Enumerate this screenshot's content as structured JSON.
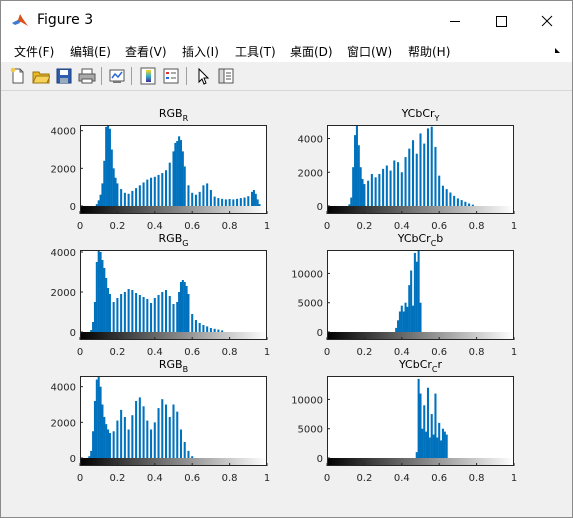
{
  "window": {
    "title": "Figure 3"
  },
  "menu": [
    "文件(F)",
    "编辑(E)",
    "查看(V)",
    "插入(I)",
    "工具(T)",
    "桌面(D)",
    "窗口(W)",
    "帮助(H)"
  ],
  "toolbar": [
    "new-figure-icon",
    "open-folder-icon",
    "save-icon",
    "print-icon",
    "link-plot-icon",
    "insert-colorbar-icon",
    "insert-legend-icon",
    "edit-plot-arrow-icon",
    "property-editor-icon"
  ],
  "colors": {
    "bars": "#0072bd"
  },
  "chart_data": [
    {
      "type": "bar",
      "title": "RGB",
      "title_sub": "R",
      "xlim": [
        0,
        1
      ],
      "ylim": [
        0,
        4300
      ],
      "xticks": [
        "0",
        "0.2",
        "0.4",
        "0.6",
        "0.8",
        "1"
      ],
      "yticks": [
        {
          "v": 0,
          "label": "0"
        },
        {
          "v": 2000,
          "label": "2000"
        },
        {
          "v": 4000,
          "label": "4000"
        }
      ],
      "colorbar": "gray",
      "x": [
        0.09,
        0.1,
        0.11,
        0.12,
        0.13,
        0.14,
        0.15,
        0.16,
        0.17,
        0.18,
        0.19,
        0.2,
        0.22,
        0.24,
        0.26,
        0.28,
        0.3,
        0.32,
        0.34,
        0.36,
        0.38,
        0.4,
        0.42,
        0.44,
        0.46,
        0.48,
        0.5,
        0.51,
        0.52,
        0.53,
        0.54,
        0.55,
        0.56,
        0.58,
        0.6,
        0.62,
        0.64,
        0.66,
        0.68,
        0.7,
        0.72,
        0.74,
        0.76,
        0.78,
        0.8,
        0.82,
        0.84,
        0.86,
        0.88,
        0.9,
        0.92,
        0.93,
        0.94,
        0.95,
        0.96
      ],
      "values": [
        100,
        300,
        600,
        1200,
        2400,
        4200,
        4300,
        4100,
        3000,
        2000,
        1500,
        1200,
        900,
        700,
        650,
        800,
        950,
        1100,
        1250,
        1400,
        1500,
        1550,
        1650,
        1750,
        1900,
        2300,
        2900,
        3350,
        3450,
        3700,
        3500,
        2900,
        2100,
        1100,
        700,
        600,
        750,
        1100,
        1200,
        850,
        500,
        420,
        380,
        350,
        370,
        350,
        380,
        420,
        450,
        520,
        750,
        850,
        650,
        350,
        100
      ]
    },
    {
      "type": "bar",
      "title": "YCbCr",
      "title_sub": "Y",
      "xlim": [
        0,
        1
      ],
      "ylim": [
        0,
        4800
      ],
      "xticks": [
        "0",
        "0.2",
        "0.4",
        "0.6",
        "0.8",
        "1"
      ],
      "yticks": [
        {
          "v": 0,
          "label": "0"
        },
        {
          "v": 2000,
          "label": "2000"
        },
        {
          "v": 4000,
          "label": "4000"
        }
      ],
      "colorbar": "gray",
      "x": [
        0.12,
        0.13,
        0.14,
        0.15,
        0.16,
        0.17,
        0.18,
        0.19,
        0.2,
        0.22,
        0.24,
        0.26,
        0.28,
        0.3,
        0.32,
        0.34,
        0.36,
        0.38,
        0.4,
        0.42,
        0.44,
        0.46,
        0.48,
        0.5,
        0.52,
        0.54,
        0.56,
        0.58,
        0.6,
        0.62,
        0.64,
        0.66,
        0.68,
        0.7,
        0.72,
        0.74,
        0.76,
        0.78
      ],
      "values": [
        100,
        500,
        2300,
        4200,
        4800,
        3600,
        2300,
        1600,
        1300,
        1500,
        1900,
        1700,
        1900,
        2200,
        2400,
        2100,
        2700,
        2600,
        2000,
        2900,
        3400,
        3900,
        3100,
        4300,
        3700,
        4600,
        4700,
        3500,
        1800,
        1200,
        1000,
        800,
        600,
        450,
        350,
        250,
        150,
        80
      ]
    },
    {
      "type": "bar",
      "title": "RGB",
      "title_sub": "G",
      "xlim": [
        0,
        1
      ],
      "ylim": [
        0,
        4100
      ],
      "xticks": [
        "0",
        "0.2",
        "0.4",
        "0.6",
        "0.8",
        "1"
      ],
      "yticks": [
        {
          "v": 0,
          "label": "0"
        },
        {
          "v": 2000,
          "label": "2000"
        },
        {
          "v": 4000,
          "label": "4000"
        }
      ],
      "colorbar": "gray",
      "x": [
        0.06,
        0.07,
        0.08,
        0.09,
        0.1,
        0.11,
        0.12,
        0.13,
        0.14,
        0.15,
        0.16,
        0.18,
        0.2,
        0.22,
        0.24,
        0.26,
        0.28,
        0.3,
        0.32,
        0.34,
        0.36,
        0.38,
        0.4,
        0.42,
        0.44,
        0.46,
        0.48,
        0.5,
        0.52,
        0.53,
        0.54,
        0.55,
        0.56,
        0.57,
        0.58,
        0.6,
        0.62,
        0.64,
        0.66,
        0.68,
        0.7,
        0.72,
        0.74,
        0.76
      ],
      "values": [
        100,
        500,
        1500,
        3500,
        4100,
        4000,
        3600,
        3200,
        2700,
        2200,
        1900,
        1500,
        1700,
        1900,
        2000,
        2150,
        2100,
        1950,
        1850,
        1750,
        1650,
        1450,
        1700,
        1850,
        2000,
        2100,
        1800,
        1400,
        1500,
        2000,
        2500,
        2600,
        2500,
        2300,
        1900,
        900,
        600,
        450,
        350,
        280,
        200,
        160,
        120,
        80
      ]
    },
    {
      "type": "bar",
      "title": "YCbCr",
      "title_sub": "C",
      "title_suffix": "b",
      "xlim": [
        0,
        1
      ],
      "ylim": [
        0,
        14000
      ],
      "xticks": [
        "0",
        "0.2",
        "0.4",
        "0.6",
        "0.8",
        "1"
      ],
      "yticks": [
        {
          "v": 0,
          "label": "0"
        },
        {
          "v": 5000,
          "label": "5000"
        },
        {
          "v": 10000,
          "label": "10000"
        }
      ],
      "colorbar": "gray",
      "x": [
        0.37,
        0.38,
        0.39,
        0.4,
        0.41,
        0.42,
        0.43,
        0.44,
        0.45,
        0.46,
        0.47,
        0.48,
        0.49,
        0.5
      ],
      "values": [
        700,
        2000,
        3500,
        4500,
        3500,
        5000,
        4300,
        8000,
        10500,
        4500,
        13500,
        12000,
        14000,
        5000
      ]
    },
    {
      "type": "bar",
      "title": "RGB",
      "title_sub": "B",
      "xlim": [
        0,
        1
      ],
      "ylim": [
        0,
        4600
      ],
      "xticks": [
        "0",
        "0.2",
        "0.4",
        "0.6",
        "0.8",
        "1"
      ],
      "yticks": [
        {
          "v": 0,
          "label": "0"
        },
        {
          "v": 2000,
          "label": "2000"
        },
        {
          "v": 4000,
          "label": "4000"
        }
      ],
      "colorbar": "gray",
      "x": [
        0.05,
        0.06,
        0.07,
        0.08,
        0.09,
        0.1,
        0.11,
        0.12,
        0.13,
        0.14,
        0.15,
        0.16,
        0.18,
        0.2,
        0.22,
        0.24,
        0.26,
        0.28,
        0.3,
        0.32,
        0.34,
        0.36,
        0.38,
        0.4,
        0.42,
        0.44,
        0.46,
        0.48,
        0.5,
        0.52,
        0.54,
        0.56,
        0.58,
        0.6
      ],
      "values": [
        100,
        400,
        1500,
        3200,
        4400,
        4600,
        4000,
        3000,
        2300,
        1900,
        1600,
        1400,
        1500,
        2100,
        2700,
        2300,
        1600,
        2400,
        3200,
        3400,
        2900,
        2100,
        1600,
        2000,
        2800,
        3300,
        3000,
        2300,
        3000,
        2600,
        1600,
        900,
        400,
        100
      ]
    },
    {
      "type": "bar",
      "title": "YCbCr",
      "title_sub": "C",
      "title_suffix": "r",
      "xlim": [
        0,
        1
      ],
      "ylim": [
        0,
        14000
      ],
      "xticks": [
        "0",
        "0.2",
        "0.4",
        "0.6",
        "0.8",
        "1"
      ],
      "yticks": [
        {
          "v": 0,
          "label": "0"
        },
        {
          "v": 5000,
          "label": "5000"
        },
        {
          "v": 10000,
          "label": "10000"
        }
      ],
      "colorbar": "gray",
      "x": [
        0.48,
        0.49,
        0.5,
        0.51,
        0.52,
        0.53,
        0.54,
        0.55,
        0.56,
        0.57,
        0.58,
        0.59,
        0.6,
        0.61,
        0.62,
        0.63,
        0.64
      ],
      "values": [
        1000,
        13500,
        11000,
        5000,
        9000,
        4500,
        12000,
        3500,
        7500,
        4000,
        11000,
        3500,
        6000,
        3000,
        5000,
        4500,
        4000
      ]
    }
  ]
}
